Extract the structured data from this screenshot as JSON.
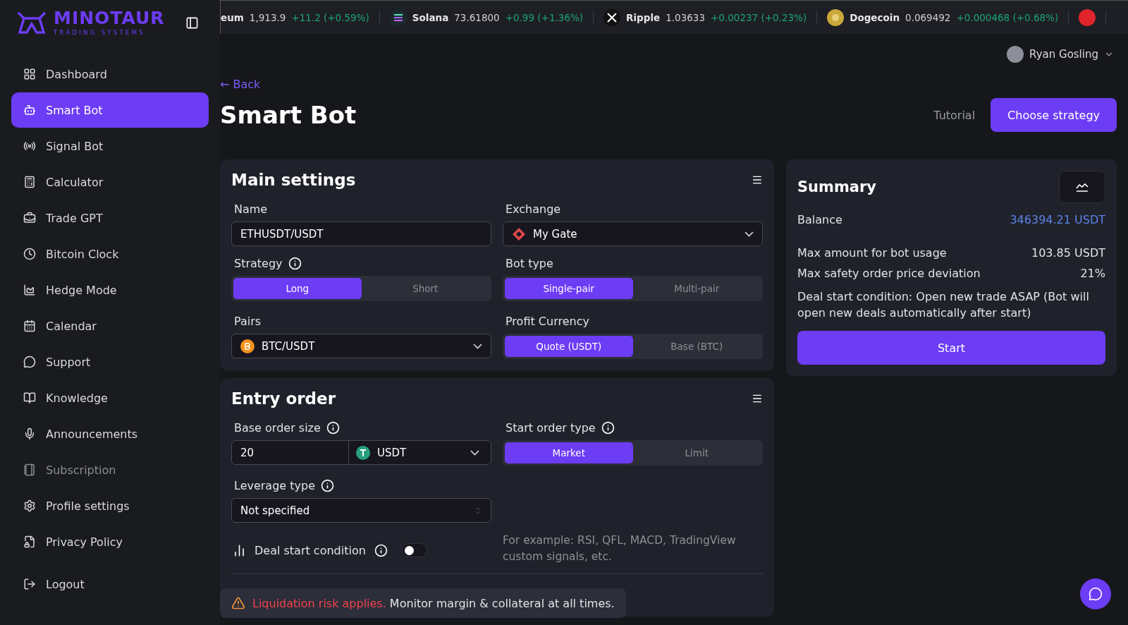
{
  "brand": {
    "name": "MINOTAUR",
    "tagline": "TRADING SYSTEMS"
  },
  "ticker": [
    {
      "name": "eum",
      "price": "1,913.9",
      "change": "+11.2 (+0.59%)",
      "kind": "none"
    },
    {
      "name": "Solana",
      "price": "73.61800",
      "change": "+0.99 (+1.36%)",
      "kind": "solana"
    },
    {
      "name": "Ripple",
      "price": "1.03633",
      "change": "+0.00237 (+0.23%)",
      "kind": "ripple"
    },
    {
      "name": "Dogecoin",
      "price": "0.069492",
      "change": "+0.000468 (+0.68%)",
      "kind": "doge"
    },
    {
      "kind": "cut"
    }
  ],
  "sidebar": {
    "items": [
      {
        "label": "Dashboard",
        "selected": false,
        "disabled": false
      },
      {
        "label": "Smart Bot",
        "selected": true,
        "disabled": false
      },
      {
        "label": "Signal Bot",
        "selected": false,
        "disabled": false
      },
      {
        "label": "Calculator",
        "selected": false,
        "disabled": false
      },
      {
        "label": "Trade GPT",
        "selected": false,
        "disabled": false
      },
      {
        "label": "Bitcoin Clock",
        "selected": false,
        "disabled": false
      },
      {
        "label": "Hedge Mode",
        "selected": false,
        "disabled": false
      },
      {
        "label": "Calendar",
        "selected": false,
        "disabled": false
      },
      {
        "label": "Support",
        "selected": false,
        "disabled": false
      },
      {
        "label": "Knowledge",
        "selected": false,
        "disabled": false
      },
      {
        "label": "Announcements",
        "selected": false,
        "disabled": false
      },
      {
        "label": "Subscription",
        "selected": false,
        "disabled": true
      },
      {
        "label": "Profile settings",
        "selected": false,
        "disabled": false
      },
      {
        "label": "Privacy Policy",
        "selected": false,
        "disabled": false
      }
    ],
    "logout": "Logout"
  },
  "user": {
    "name": "Ryan Gosling"
  },
  "back": "← Back",
  "title": "Smart Bot",
  "tutorial": "Tutorial",
  "choose_strategy": "Choose strategy",
  "main_settings": {
    "title": "Main settings",
    "name": {
      "label": "Name",
      "value": "ETHUSDT/USDT"
    },
    "exchange": {
      "label": "Exchange",
      "value": "My Gate"
    },
    "strategy": {
      "label": "Strategy",
      "options": [
        {
          "label": "Long",
          "selected": true
        },
        {
          "label": "Short",
          "selected": false
        }
      ]
    },
    "bot_type": {
      "label": "Bot type",
      "options": [
        {
          "label": "Single-pair",
          "selected": true
        },
        {
          "label": "Multi-pair",
          "selected": false
        }
      ]
    },
    "pairs": {
      "label": "Pairs",
      "value": "BTC/USDT"
    },
    "profit_currency": {
      "label": "Profit Currency",
      "options": [
        {
          "label": "Quote (USDT)",
          "selected": true
        },
        {
          "label": "Base (BTC)",
          "selected": false
        }
      ]
    }
  },
  "entry_order": {
    "title": "Entry order",
    "base_order_size": {
      "label": "Base order size",
      "value": "20",
      "currency": "USDT"
    },
    "start_order_type": {
      "label": "Start order type",
      "options": [
        {
          "label": "Market",
          "selected": true
        },
        {
          "label": "Limit",
          "selected": false
        }
      ]
    },
    "leverage_type": {
      "label": "Leverage type",
      "value": "Not specified"
    },
    "deal_start_condition": {
      "label": "Deal start condition",
      "on": false,
      "hint": "For example: RSI, QFL, MACD, TradingView custom signals, etc."
    }
  },
  "summary": {
    "title": "Summary",
    "rows": [
      {
        "label": "Balance",
        "value": "346394.21 USDT",
        "kind": "link"
      },
      {
        "label": "Max amount for bot usage",
        "value": "103.85 USDT",
        "kind": "plain"
      },
      {
        "label": "Max safety order price deviation",
        "value": "21%",
        "kind": "plain"
      }
    ],
    "note": "Deal start condition: Open new trade ASAP (Bot will open new deals automatically after start)",
    "start": "Start"
  },
  "toast": {
    "highlight": "Liquidation risk applies.",
    "text": "Monitor margin & collateral at all times."
  }
}
